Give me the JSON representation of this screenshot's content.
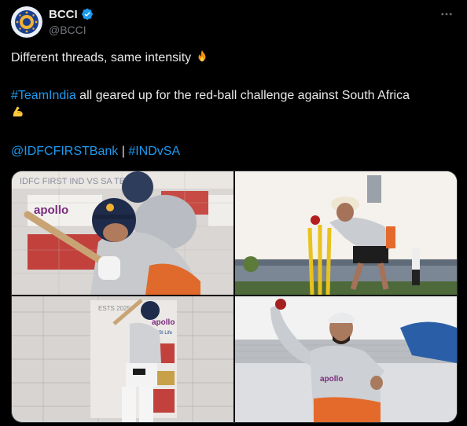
{
  "author": {
    "name": "BCCI",
    "handle": "@BCCI",
    "verified": true,
    "avatar": "bcci-logo",
    "badge_color": "#1d9bf0"
  },
  "post": {
    "line1": "Different threads, same intensity",
    "line1_emoji": "fire-emoji",
    "hashtag1": "#TeamIndia",
    "line2_rest": " all geared up for the red-ball challenge against South Africa",
    "line2_emoji": "flexed-biceps-emoji",
    "mention": "@IDFCFIRSTBank",
    "separator": " | ",
    "hashtag2": "#INDvSA"
  },
  "media": {
    "count": 4,
    "photo1": {
      "banner_text": "IDFC FIRST  IND VS SA TE",
      "sponsor": "apollo"
    },
    "photo2": {
      "subject": "wicketkeeping-drill"
    },
    "photo3": {
      "banner_text": "ESTS 2025",
      "sponsor": "apollo",
      "board": "SBI Life"
    },
    "photo4": {
      "subject": "bowling-practice",
      "shirt_text": "apollo"
    }
  },
  "colors": {
    "background": "#000000",
    "text": "#e7e9ea",
    "secondary": "#71767b",
    "link": "#1d9bf0",
    "border": "#2f3336"
  }
}
